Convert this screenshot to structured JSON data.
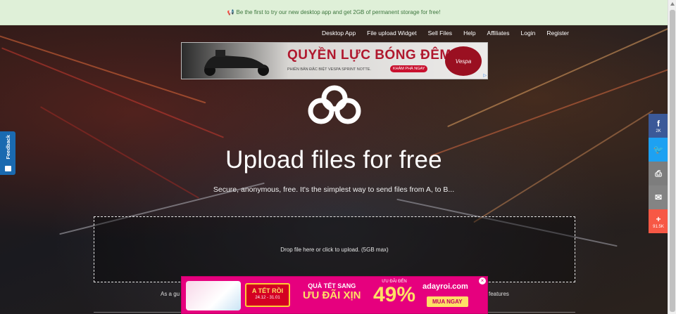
{
  "banner": {
    "text": "Be the first to try our new desktop app and get 2GB of permanent storage for free!"
  },
  "nav": {
    "items": [
      "Desktop App",
      "File upload Widget",
      "Sell Files",
      "Help",
      "Affiliates",
      "Login",
      "Register"
    ]
  },
  "ad_top": {
    "headline": "QUYỀN LỰC BÓNG ĐÊM",
    "sub": "PHIÊN BẢN ĐẶC BIỆT VESPA SPRINT NOTTE.",
    "cta": "KHÁM PHÁ NGAY",
    "brand": "Vespa"
  },
  "hero": {
    "title": "Upload files for free",
    "subtitle": "Secure, anonymous, free. It's the simplest way to send files from A, to B...",
    "dropzone": "Drop file here or click to upload. (5GB max)",
    "below_left": "As a gu",
    "below_right": "features"
  },
  "ad_bottom": {
    "tet_title": "A TẾT RỒI",
    "tet_dates": "24.12 - 31.01",
    "line1": "QUÀ TẾT SANG",
    "line2": "ƯU ĐÃI XỊN",
    "pct_label": "ƯU ĐÃI ĐẾN",
    "pct": "49%",
    "brand": "adayroi.com",
    "buy": "MUA NGAY"
  },
  "feedback": {
    "label": "Feedback"
  },
  "share": {
    "facebook_count": "2K",
    "plus_count": "91.5K"
  },
  "colors": {
    "banner_bg": "#dff0d8",
    "feedback": "#1a6ab0",
    "facebook": "#3b5998",
    "twitter": "#1da1f2",
    "print": "#7d7d7d",
    "email": "#848484",
    "plus": "#f75845"
  }
}
